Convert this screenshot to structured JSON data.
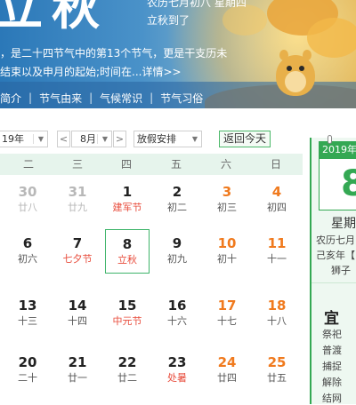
{
  "banner": {
    "term_title": "立秋",
    "lunar_top": "农历七月初八  星期四",
    "dated_line": "立秋到了",
    "desc_line1": "，是二十四节气中的第13个节气，更是干支历未",
    "desc_line2": "结束以及申月的起始;时间在...",
    "more_link": "详情>>",
    "nav": [
      "简介",
      "节气由来",
      "气候常识",
      "节气习俗"
    ]
  },
  "controls": {
    "year": "19年",
    "month": "8月",
    "holiday": "放假安排",
    "prev": "<",
    "next": ">",
    "today": "返回今天"
  },
  "weekdays": [
    "二",
    "三",
    "四",
    "五",
    "六",
    "日"
  ],
  "weeks": [
    [
      {
        "day": "30",
        "sub": "廿八",
        "style": "grey"
      },
      {
        "day": "31",
        "sub": "廿九",
        "style": "grey"
      },
      {
        "day": "1",
        "sub": "建军节",
        "style": "black",
        "sub_red": true
      },
      {
        "day": "2",
        "sub": "初二",
        "style": "black"
      },
      {
        "day": "3",
        "sub": "初三",
        "style": "orange"
      },
      {
        "day": "4",
        "sub": "初四",
        "style": "orange"
      }
    ],
    [
      {
        "day": "6",
        "sub": "初六",
        "style": "black"
      },
      {
        "day": "7",
        "sub": "七夕节",
        "style": "black",
        "sub_red": true
      },
      {
        "day": "8",
        "sub": "立秋",
        "style": "black",
        "sub_red": true,
        "selected": true
      },
      {
        "day": "9",
        "sub": "初九",
        "style": "black"
      },
      {
        "day": "10",
        "sub": "初十",
        "style": "orange"
      },
      {
        "day": "11",
        "sub": "十一",
        "style": "orange"
      }
    ],
    [
      {
        "day": "13",
        "sub": "十三",
        "style": "black"
      },
      {
        "day": "14",
        "sub": "十四",
        "style": "black"
      },
      {
        "day": "15",
        "sub": "中元节",
        "style": "black",
        "sub_red": true
      },
      {
        "day": "16",
        "sub": "十六",
        "style": "black"
      },
      {
        "day": "17",
        "sub": "十七",
        "style": "orange"
      },
      {
        "day": "18",
        "sub": "十八",
        "style": "orange"
      }
    ],
    [
      {
        "day": "20",
        "sub": "二十",
        "style": "black"
      },
      {
        "day": "21",
        "sub": "廿一",
        "style": "black"
      },
      {
        "day": "22",
        "sub": "廿二",
        "style": "black"
      },
      {
        "day": "23",
        "sub": "处暑",
        "style": "black",
        "sub_red": true
      },
      {
        "day": "24",
        "sub": "廿四",
        "style": "orange"
      },
      {
        "day": "25",
        "sub": "廿五",
        "style": "orange"
      }
    ]
  ],
  "right_panel": {
    "year_label": "2019年",
    "day": "8",
    "weekday": "星期",
    "lunar": "农历七月",
    "ganzhi": "己亥年【",
    "shengxiao": "狮子",
    "yi_title": "宜",
    "yi_items": [
      "祭祀",
      "普渡",
      "捕捉",
      "解除",
      "结网"
    ]
  },
  "colors": {
    "accent_green": "#34a853",
    "weekend_orange": "#f07a1e",
    "festival_red": "#e84d3d"
  }
}
